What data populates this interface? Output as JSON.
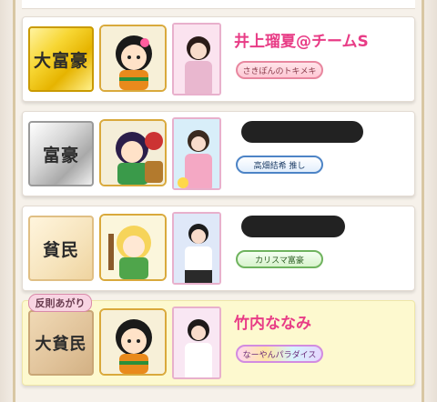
{
  "ranks": [
    {
      "title": "大富豪",
      "name": "井上瑠夏@チームS",
      "badge": "さきぽんのトキメキ",
      "redacted": false,
      "highlight": false,
      "tag": ""
    },
    {
      "title": "富豪",
      "name": "",
      "badge": "高畑結希 推し",
      "redacted": true,
      "highlight": false,
      "tag": ""
    },
    {
      "title": "貧民",
      "name": "",
      "badge": "カリスマ富豪",
      "redacted": true,
      "highlight": false,
      "tag": ""
    },
    {
      "title": "大貧民",
      "name": "竹内ななみ",
      "badge": "なーやんパラダイス",
      "redacted": false,
      "highlight": true,
      "tag": "反則あがり"
    }
  ],
  "colors": {
    "name_pink": "#e83c86",
    "gold": "#e6b400",
    "silver": "#a9a9a9"
  },
  "icons": [
    "chibi-avatar-icon",
    "member-photo-card"
  ]
}
